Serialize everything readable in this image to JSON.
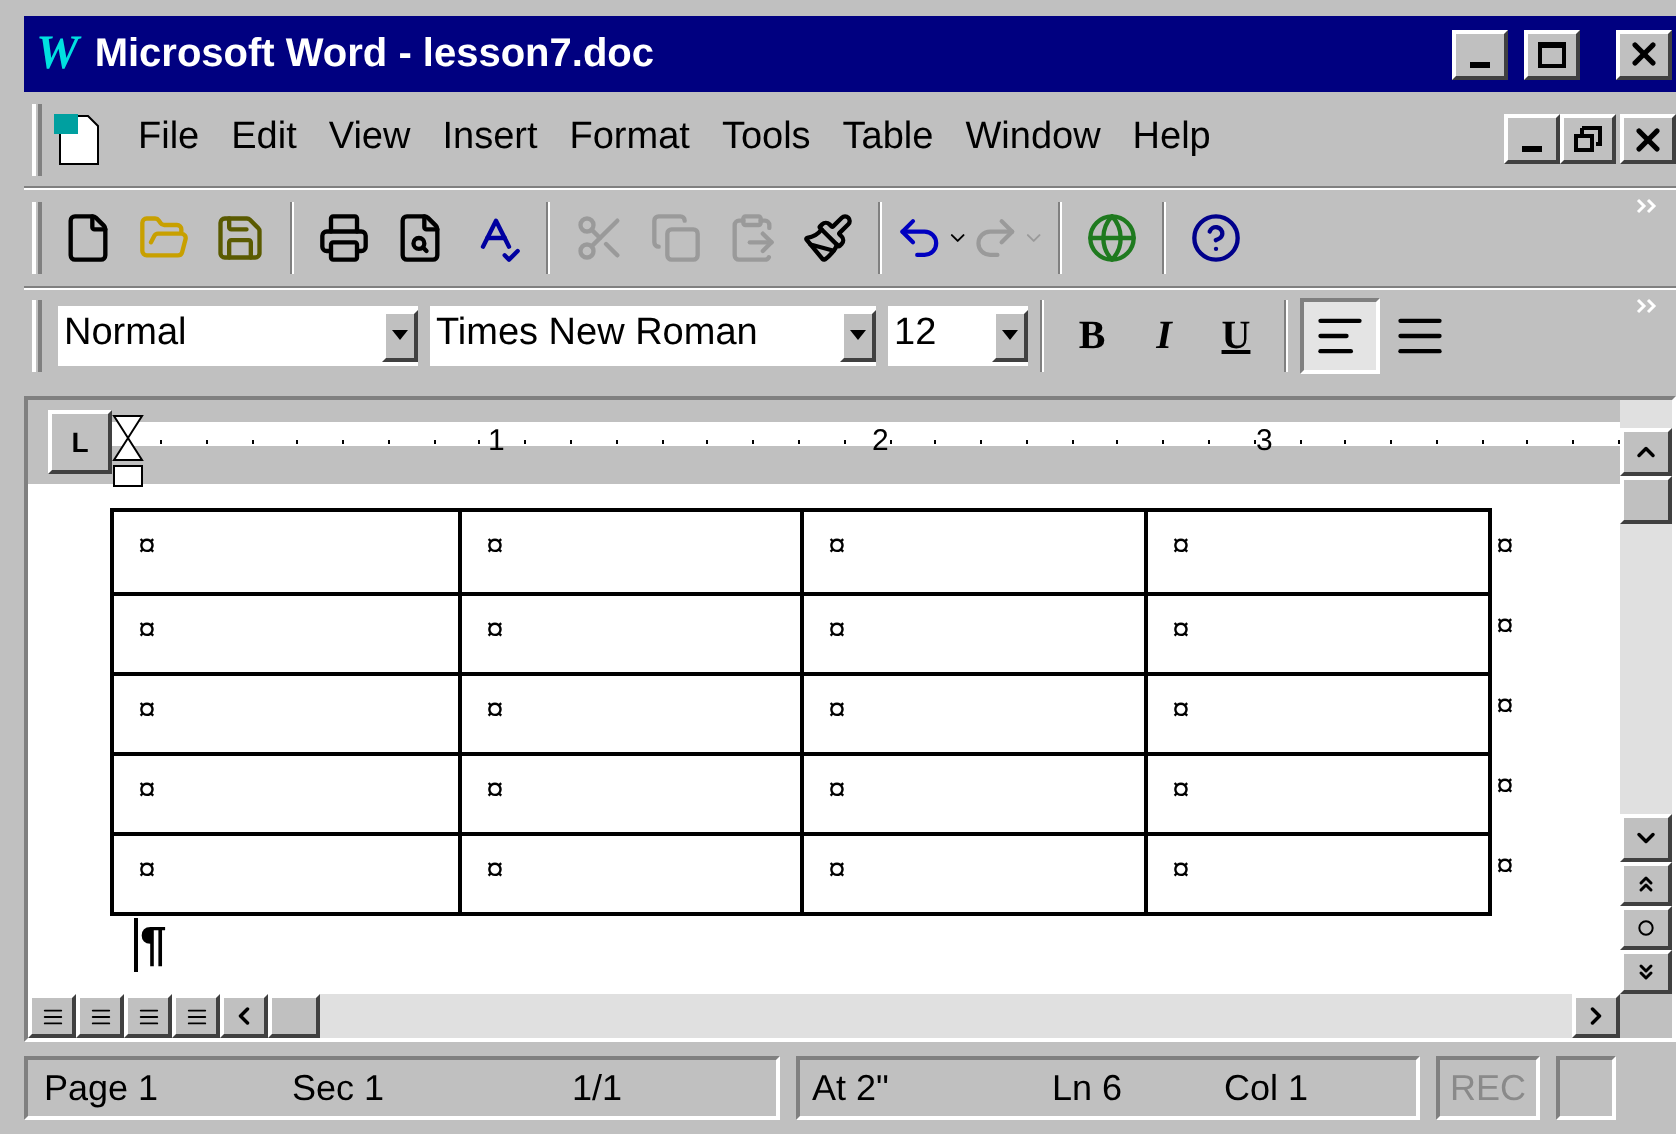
{
  "window": {
    "logo": "W",
    "title": "Microsoft Word - lesson7.doc"
  },
  "menu": [
    {
      "label": "File"
    },
    {
      "label": "Edit"
    },
    {
      "label": "View"
    },
    {
      "label": "Insert"
    },
    {
      "label": "Format"
    },
    {
      "label": "Tools"
    },
    {
      "label": "Table"
    },
    {
      "label": "Window"
    },
    {
      "label": "Help"
    }
  ],
  "standard_toolbar": [
    {
      "kind": "new",
      "disabled": false
    },
    {
      "kind": "open",
      "disabled": false
    },
    {
      "kind": "save",
      "disabled": false
    },
    {
      "kind": "sep"
    },
    {
      "kind": "print",
      "disabled": false
    },
    {
      "kind": "preview",
      "disabled": false
    },
    {
      "kind": "spelling",
      "disabled": false
    },
    {
      "kind": "sep"
    },
    {
      "kind": "cut",
      "disabled": true
    },
    {
      "kind": "copy",
      "disabled": true
    },
    {
      "kind": "paste",
      "disabled": true
    },
    {
      "kind": "format-painter",
      "disabled": false
    },
    {
      "kind": "sep"
    },
    {
      "kind": "undo",
      "disabled": false
    },
    {
      "kind": "redo",
      "disabled": true
    },
    {
      "kind": "sep"
    },
    {
      "kind": "web",
      "disabled": false
    },
    {
      "kind": "sep"
    },
    {
      "kind": "help",
      "disabled": false
    }
  ],
  "formatting_toolbar": {
    "style": "Normal",
    "font": "Times New Roman",
    "size": "12",
    "buttons": [
      {
        "label": "B",
        "kind": "bold",
        "selected": false
      },
      {
        "label": "I",
        "kind": "italic",
        "selected": false
      },
      {
        "label": "U",
        "kind": "underline",
        "selected": false
      }
    ],
    "align": [
      {
        "kind": "left",
        "selected": true
      },
      {
        "kind": "center",
        "selected": false
      }
    ]
  },
  "ruler": {
    "tab_selector": "L",
    "numbers": [
      "1",
      "2",
      "3"
    ]
  },
  "table": {
    "rows": [
      [
        "¤",
        "¤",
        "¤",
        "¤"
      ],
      [
        "¤",
        "¤",
        "¤",
        "¤"
      ],
      [
        "¤",
        "¤",
        "¤",
        "¤"
      ],
      [
        "¤",
        "¤",
        "¤",
        "¤"
      ],
      [
        "¤",
        "¤",
        "¤",
        "¤"
      ]
    ],
    "row_end_mark": "¤"
  },
  "paragraph_mark": "¶",
  "status_bar": {
    "page": "Page 1",
    "section": "Sec 1",
    "pages": "1/1",
    "at": "At 2\"",
    "line": "Ln 6",
    "column": "Col 1",
    "rec": {
      "label": "REC",
      "disabled": true
    }
  }
}
